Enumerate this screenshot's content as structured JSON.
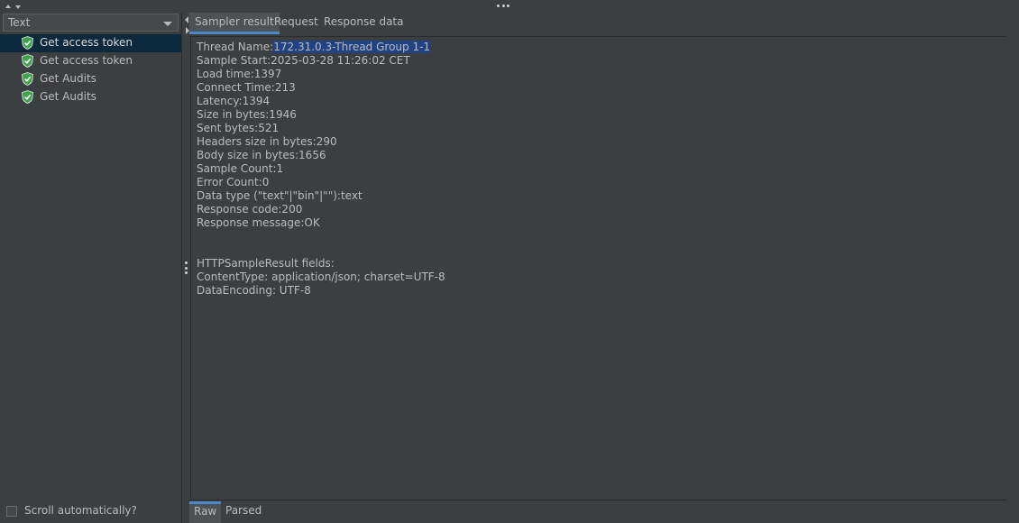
{
  "left_panel": {
    "renderer_select": {
      "value": "Text"
    },
    "results_tree": [
      {
        "label": "Get access token",
        "icon": "success-shield-icon",
        "selected": true
      },
      {
        "label": "Get access token",
        "icon": "success-shield-icon",
        "selected": false
      },
      {
        "label": "Get Audits",
        "icon": "success-shield-icon",
        "selected": false
      },
      {
        "label": "Get Audits",
        "icon": "success-shield-icon",
        "selected": false
      }
    ],
    "scroll_automatically": {
      "label": "Scroll automatically?",
      "checked": false
    }
  },
  "right_panel": {
    "tabs": [
      {
        "label": "Sampler result",
        "active": true
      },
      {
        "label": "Request",
        "active": false
      },
      {
        "label": "Response data",
        "active": false
      }
    ],
    "sampler_result": {
      "thread_name_label": "Thread Name:",
      "thread_name_value": "172.31.0.3-Thread Group 1-1",
      "lines": [
        "Sample Start:2025-03-28 11:26:02 CET",
        "Load time:1397",
        "Connect Time:213",
        "Latency:1394",
        "Size in bytes:1946",
        "Sent bytes:521",
        "Headers size in bytes:290",
        "Body size in bytes:1656",
        "Sample Count:1",
        "Error Count:0",
        "Data type (\"text\"|\"bin\"|\"\"):text",
        "Response code:200",
        "Response message:OK"
      ],
      "http_fields": [
        "HTTPSampleResult fields:",
        "ContentType: application/json; charset=UTF-8",
        "DataEncoding: UTF-8"
      ]
    },
    "bottom_tabs": [
      {
        "label": "Raw",
        "active": true
      },
      {
        "label": "Parsed",
        "active": false
      }
    ]
  },
  "colors": {
    "background": "#3c3f41",
    "selection": "#0d293e",
    "text_highlight": "#214283",
    "accent": "#4a88c7",
    "success_green": "#3fa34d"
  }
}
